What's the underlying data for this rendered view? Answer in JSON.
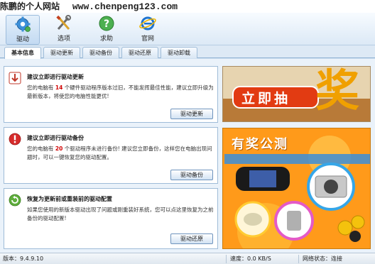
{
  "watermark": {
    "text": "陈鹏的个人网站",
    "url": "www.chenpeng123.com"
  },
  "toolbar": {
    "items": [
      {
        "label": "驱动",
        "icon": "gear-drive-icon",
        "active": true
      },
      {
        "label": "选项",
        "icon": "tools-icon"
      },
      {
        "label": "求助",
        "icon": "help-icon"
      },
      {
        "label": "官网",
        "icon": "ie-browser-icon"
      }
    ]
  },
  "tabs": [
    {
      "label": "基本信息",
      "active": true
    },
    {
      "label": "驱动更新"
    },
    {
      "label": "驱动备份"
    },
    {
      "label": "驱动还原"
    },
    {
      "label": "驱动卸载"
    }
  ],
  "cards": {
    "update": {
      "title": "建议立即进行驱动更新",
      "desc_pre": "您的电脑有 ",
      "desc_num": "14",
      "desc_post": " 个硬件驱动程序版本过旧，不能发挥最佳性能，建议立即升级为最新版本，将使您的电脑性能更优!",
      "button": "驱动更新",
      "icon": "update-download-icon"
    },
    "backup": {
      "title": "建议立即进行驱动备份",
      "desc_pre": "您的电脑有 ",
      "desc_num": "20",
      "desc_post": " 个驱动程序未进行备份! 建议您立即备份，这样您在电脑出现问题时，可以一键恢复您的驱动配置。",
      "button": "驱动备份",
      "icon": "warning-icon"
    },
    "restore": {
      "title": "恢复为更新前或重装前的驱动配置",
      "desc": "如果您使用的新版本驱动出现了问题或刚重装好系统，您可以点这里恢复为之前备份的驱动配置!",
      "button": "驱动还原",
      "icon": "restore-icon"
    }
  },
  "ads": {
    "top": {
      "text_small": "立即抽",
      "text_big": "奖"
    },
    "bottom": {
      "title": "有奖公测"
    }
  },
  "statusbar": {
    "version": "版本：9.4.9.10",
    "speed": "速度：0.0 KB/S",
    "network": "网络状态：连接"
  },
  "colors": {
    "accent": "#2f6fb5",
    "highlight_number": "#d00000",
    "ad_orange": "#ff9a1a"
  }
}
